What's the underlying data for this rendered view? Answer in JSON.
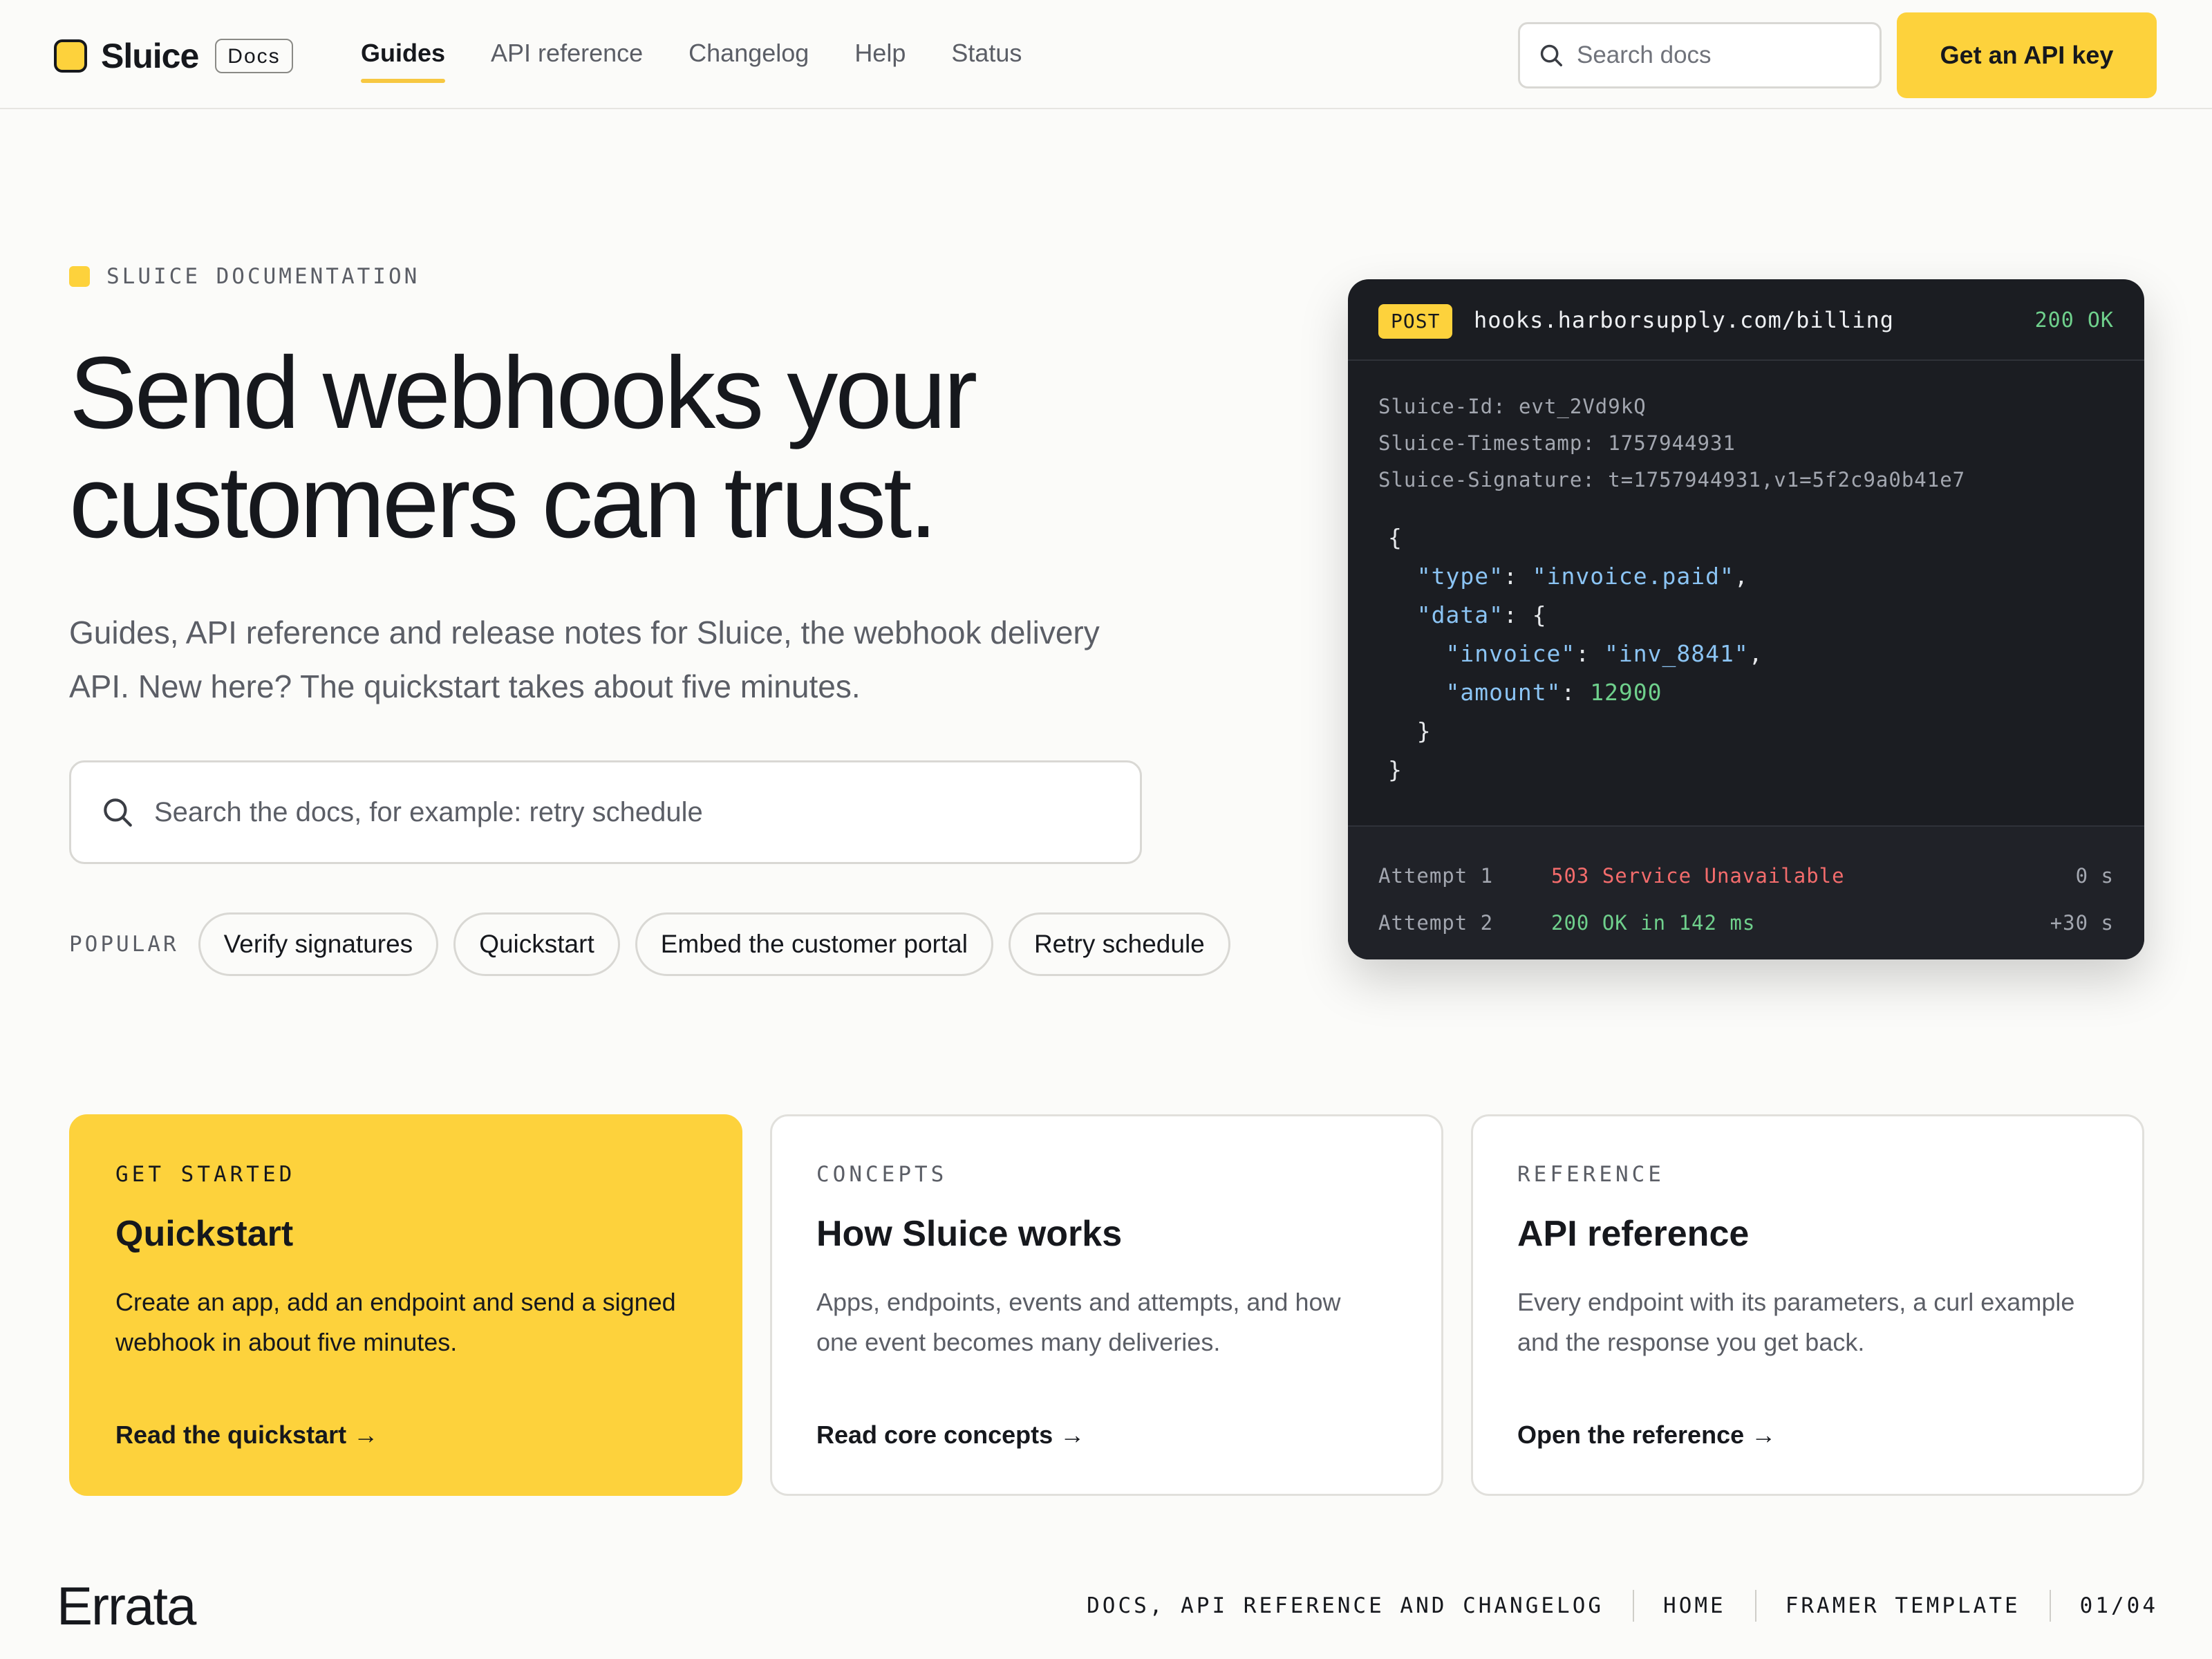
{
  "header": {
    "brand": "Sluice",
    "docs_badge": "Docs",
    "nav": [
      "Guides",
      "API reference",
      "Changelog",
      "Help",
      "Status"
    ],
    "active_nav": "Guides",
    "search_placeholder": "Search docs",
    "cta": "Get an API key"
  },
  "hero": {
    "eyebrow": "SLUICE DOCUMENTATION",
    "title_line1": "Send webhooks your",
    "title_line2": "customers can trust.",
    "subtitle_line1": "Guides, API reference and release notes for Sluice, the webhook delivery",
    "subtitle_line2": "API. New here? The quickstart takes about five minutes.",
    "search_placeholder": "Search the docs, for example: retry schedule",
    "popular_label": "POPULAR",
    "popular": [
      "Verify signatures",
      "Quickstart",
      "Embed the customer portal",
      "Retry schedule"
    ]
  },
  "code": {
    "method": "POST",
    "url": "hooks.harborsupply.com/billing",
    "status": "200 OK",
    "headers": [
      "Sluice-Id: evt_2Vd9kQ",
      "Sluice-Timestamp: 1757944931",
      "Sluice-Signature: t=1757944931,v1=5f2c9a0b41e7"
    ],
    "json": {
      "open": "{",
      "type_key": "\"type\"",
      "type_val": "\"invoice.paid\"",
      "data_key": "\"data\"",
      "invoice_key": "\"invoice\"",
      "invoice_val": "\"inv_8841\"",
      "amount_key": "\"amount\"",
      "amount_val": "12900",
      "close_inner": "}",
      "close": "}"
    },
    "attempts": [
      {
        "label": "Attempt 1",
        "result": "503 Service Unavailable",
        "time": "0 s",
        "status": "error"
      },
      {
        "label": "Attempt 2",
        "result": "200 OK in 142 ms",
        "time": "+30 s",
        "status": "ok"
      }
    ]
  },
  "cards": [
    {
      "kicker": "GET STARTED",
      "title": "Quickstart",
      "desc_line1": "Create an app, add an endpoint and send a signed",
      "desc_line2": "webhook in about five minutes.",
      "link": "Read the quickstart →"
    },
    {
      "kicker": "CONCEPTS",
      "title": "How Sluice works",
      "desc_line1": "Apps, endpoints, events and attempts, and how",
      "desc_line2": "one event becomes many deliveries.",
      "link": "Read core concepts →"
    },
    {
      "kicker": "REFERENCE",
      "title": "API reference",
      "desc_line1": "Every endpoint with its parameters, a curl example",
      "desc_line2": "and the response you get back.",
      "link": "Open the reference →"
    }
  ],
  "footer": {
    "logo": "Errata",
    "meta": [
      "DOCS, API REFERENCE AND CHANGELOG",
      "HOME",
      "FRAMER TEMPLATE",
      "01/04"
    ]
  },
  "colors": {
    "accent": "#fdd23c",
    "background": "#fbfbf9",
    "code_bg": "#1b1d22",
    "ok": "#6fd08c",
    "error": "#f36c6c"
  }
}
